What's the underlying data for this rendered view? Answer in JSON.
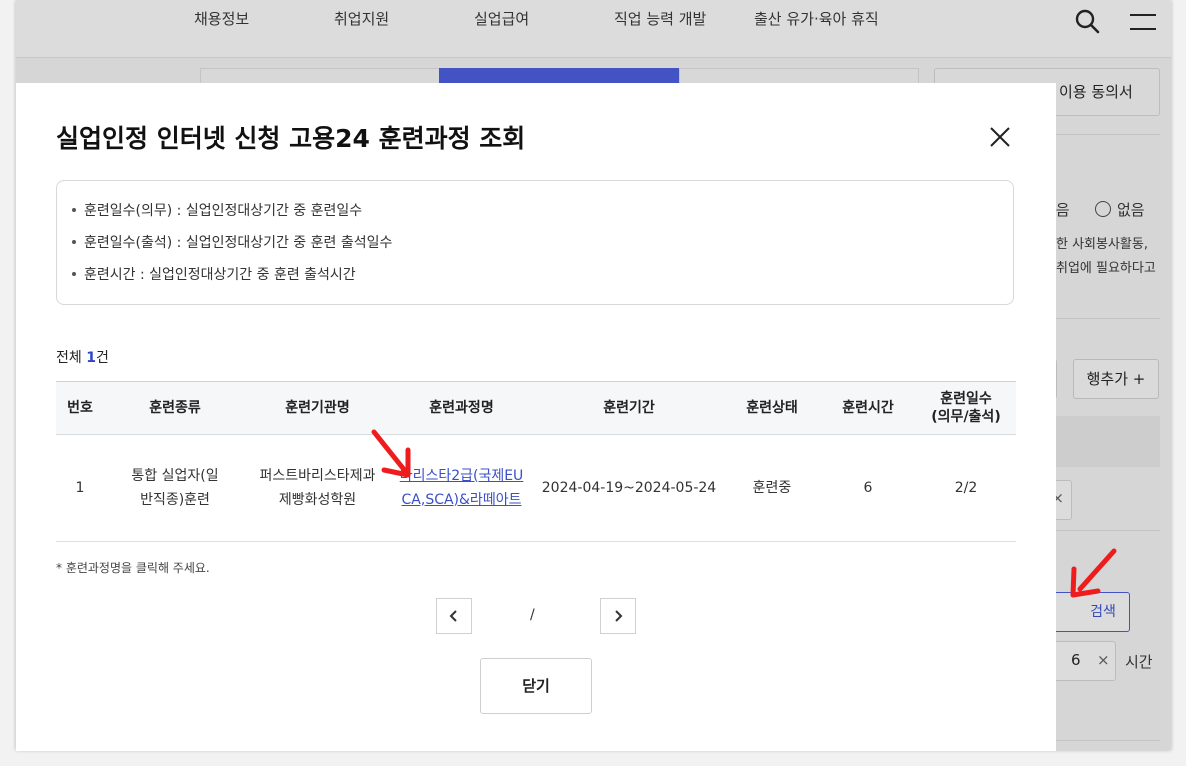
{
  "background": {
    "nav": [
      "채용정보",
      "취업지원",
      "실업급여",
      "직업 능력 개발",
      "출산 유가·육아 휴직"
    ],
    "consent_label": "이용 동의서",
    "radio_yes": "있음",
    "radio_no": "없음",
    "desc_line1": "한 사회봉사활동,",
    "desc_line2": "취업에 필요하다고",
    "add_row": "행추가 +",
    "search_button": "검색",
    "field_value": "6",
    "field_unit": "시간",
    "clear_symbol": "×"
  },
  "modal": {
    "title": "실업인정 인터넷 신청 고용24 훈련과정 조회",
    "info": [
      "훈련일수(의무) : 실업인정대상기간 중 훈련일수",
      "훈련일수(출석) : 실업인정대상기간 중 훈련 출석일수",
      "훈련시간 : 실업인정대상기간 중 훈련 출석시간"
    ],
    "total_prefix": "전체 ",
    "total_count": "1",
    "total_suffix": "건",
    "columns": [
      "번호",
      "훈련종류",
      "훈련기관명",
      "훈련과정명",
      "훈련기간",
      "훈련상태",
      "훈련시간",
      "훈련일수",
      "(의무/출석)"
    ],
    "rows": [
      {
        "no": "1",
        "type": "통합 실업자(일반직종)훈련",
        "institution": "퍼스트바리스타제과제빵화성학원",
        "course": "바리스타2급(국제EUCA,SCA)&라떼아트",
        "period": "2024-04-19~2024-05-24",
        "status": "훈련중",
        "hours": "6",
        "days": "2/2"
      }
    ],
    "note": "* 훈련과정명을 클릭해 주세요.",
    "pager_slash": "/",
    "close_button": "닫기"
  },
  "colors": {
    "accent": "#2f45c7",
    "annotation_arrow": "#ee1c1c"
  }
}
